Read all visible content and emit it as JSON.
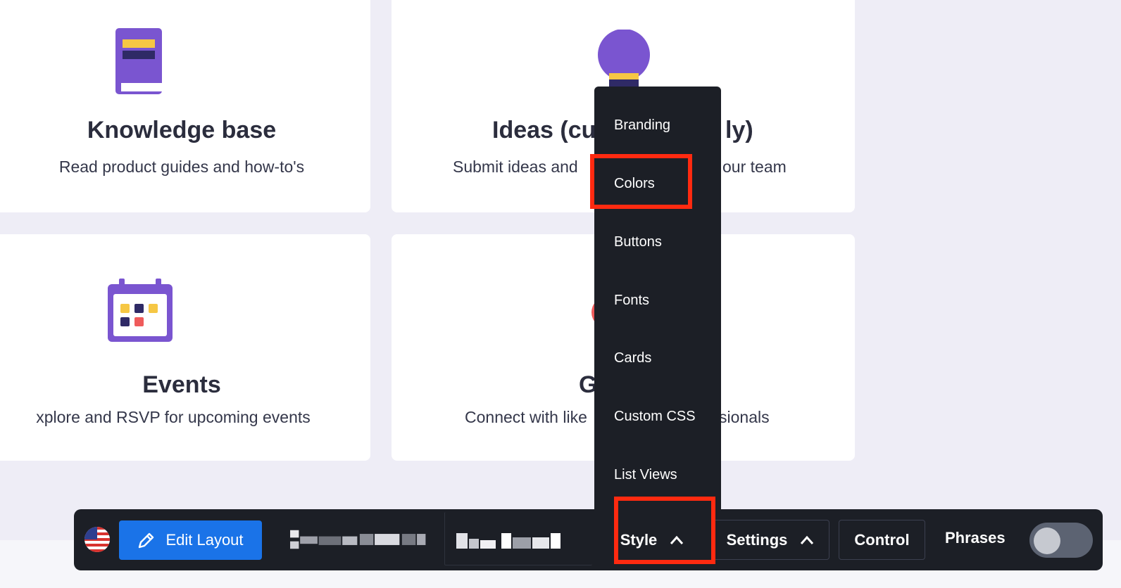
{
  "cards": [
    {
      "title": "Knowledge base",
      "description": "Read product guides and how-to's",
      "icon": "book-icon"
    },
    {
      "title": "Ideas (cu",
      "title_end": "ly)",
      "description": "Submit ideas and",
      "description_end": "our team",
      "icon": "lightbulb-icon"
    },
    {
      "title": "Events",
      "description": "xplore and RSVP for upcoming events",
      "icon": "calendar-icon"
    },
    {
      "title": "G",
      "description": "Connect with like",
      "description_end": "sionals",
      "icon": "group-icon"
    }
  ],
  "style_menu": {
    "items": [
      "Branding",
      "Colors",
      "Buttons",
      "Fonts",
      "Cards",
      "Custom CSS",
      "List Views"
    ],
    "highlighted": "Colors"
  },
  "toolbar": {
    "flag_icon": "us-flag-icon",
    "edit_layout_label": "Edit Layout",
    "style_label": "Style",
    "settings_label": "Settings",
    "control_label": "Control",
    "phrases_label": "Phrases",
    "phrases_enabled": false
  },
  "colors": {
    "toolbar_bg": "#1c1f26",
    "accent_blue": "#1a73e8",
    "highlight_red": "#ff2a10",
    "icon_purple": "#7a55d0",
    "icon_yellow": "#f6c744",
    "icon_navy": "#2f2a66",
    "icon_red": "#ef5b5b"
  }
}
